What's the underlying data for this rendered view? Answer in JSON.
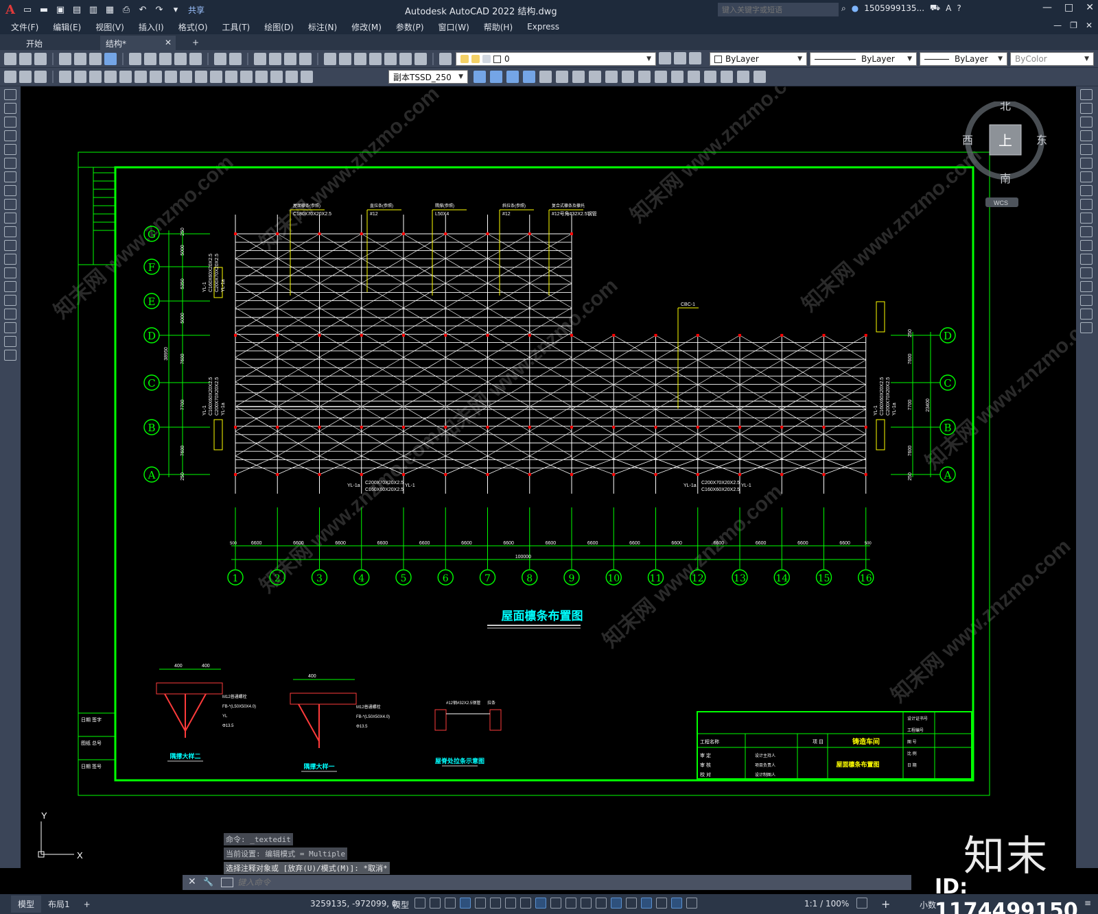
{
  "titlebar": {
    "logo": "A",
    "share": "共享",
    "title": "Autodesk AutoCAD 2022    结构.dwg",
    "search_placeholder": "键入关键字或短语",
    "user": "1505999135...",
    "icons": [
      "new-icon",
      "open-icon",
      "save-icon",
      "saveas-icon",
      "plot-icon",
      "undo-icon",
      "redo-icon"
    ]
  },
  "menu": [
    "文件(F)",
    "编辑(E)",
    "视图(V)",
    "插入(I)",
    "格式(O)",
    "工具(T)",
    "绘图(D)",
    "标注(N)",
    "修改(M)",
    "参数(P)",
    "窗口(W)",
    "帮助(H)",
    "Express"
  ],
  "tabs": [
    {
      "label": "开始"
    },
    {
      "label": "结构*"
    }
  ],
  "toolbar": {
    "layer_value": "0",
    "color": "ByLayer",
    "linetype": "ByLayer",
    "lineweight": "ByLayer",
    "plotstyle": "ByColor",
    "dimstyle": "副本TSSD_250"
  },
  "viewcube": {
    "north": "北",
    "south": "南",
    "east": "东",
    "west": "西",
    "top": "上",
    "wcs": "WCS"
  },
  "drawing": {
    "title": "屋面檩条布置图",
    "grid_rows": [
      "G",
      "F",
      "E",
      "D",
      "C",
      "B",
      "A"
    ],
    "grid_cols": [
      "1",
      "2",
      "3",
      "4",
      "5",
      "6",
      "7",
      "8",
      "9",
      "10",
      "11",
      "12",
      "13",
      "14",
      "15",
      "16"
    ],
    "bay_dim": "6600",
    "end_dim": "500",
    "total_dim": "100000",
    "left_dims": [
      "250",
      "5000",
      "5350",
      "5000",
      "7600",
      "7700",
      "7600",
      "250"
    ],
    "left_total": "38950",
    "right_dims": [
      "250",
      "7600",
      "7700",
      "7600",
      "250"
    ],
    "right_total": "23400",
    "top_labels": [
      "屋面檩条(参照)",
      "直拉条(参照)",
      "隅撑(参照)",
      "斜拉条(参照)",
      "复合式檩条及檩托"
    ],
    "top_values": [
      "C180X70X20X2.5",
      "#12",
      "L50X4",
      "#12",
      "#12号角#32X2.5钢管"
    ],
    "side_labels": [
      "YL-1",
      "C160X60X20X2.5",
      "C200X70X20X2.5",
      "YL-1a"
    ],
    "bottom_labels": [
      "YL-1a",
      "C200X70X20X2.5",
      "C160X60X20X2.5",
      "YL-1"
    ],
    "cbc": "CBC-1",
    "details": [
      {
        "title": "隅撑大样二",
        "notes": [
          "M12普通螺栓",
          "FB-*(L50X50X4.0)",
          "YL",
          "Φ13.5"
        ]
      },
      {
        "title": "隅撑大样一",
        "notes": [
          "M12普通螺栓",
          "FB-*(L50X50X4.0)",
          "Φ13.5"
        ]
      },
      {
        "title": "屋脊处拉条示意图",
        "notes": [
          "#12钢#32X2.5钢管",
          "拉条"
        ]
      }
    ],
    "detail_dims": [
      "400",
      "400",
      "400"
    ],
    "titleblock": {
      "project_label": "项 目",
      "project": "铸造车间",
      "drawing": "屋面檩条布置图",
      "unit_label": "工程名称",
      "rows": [
        "审 定",
        "审 核",
        "校 对"
      ],
      "roles": [
        "设计主持人",
        "项目负责人",
        "设计制图人"
      ],
      "right": [
        "设计证书号",
        "工程编号",
        "图 号",
        "比 例",
        "日 期"
      ]
    },
    "left_strip": [
      "日期 签字",
      "图纸 总号",
      "日期 签号"
    ]
  },
  "command": {
    "history": [
      "命令: _textedit",
      "当前设置: 编辑模式 = Multiple",
      "选择注释对象或 [放弃(U)/模式(M)]: *取消*"
    ],
    "placeholder": "键入命令"
  },
  "status": {
    "tabs": [
      "模型",
      "布局1"
    ],
    "coords": "3259135, -972099, 0",
    "space": "模型",
    "scale": "1:1 / 100%",
    "units": "小数"
  },
  "watermark": {
    "brand": "知末",
    "id": "ID: 1174499150",
    "site": "www.znzmo.com",
    "cn": "知末网"
  },
  "colors": {
    "grid": "#00ff00",
    "purlin": "#ffffff",
    "yellow": "#ffff00",
    "cyan": "#00ffff",
    "red": "#ff0000",
    "frame": "#00ff00"
  }
}
